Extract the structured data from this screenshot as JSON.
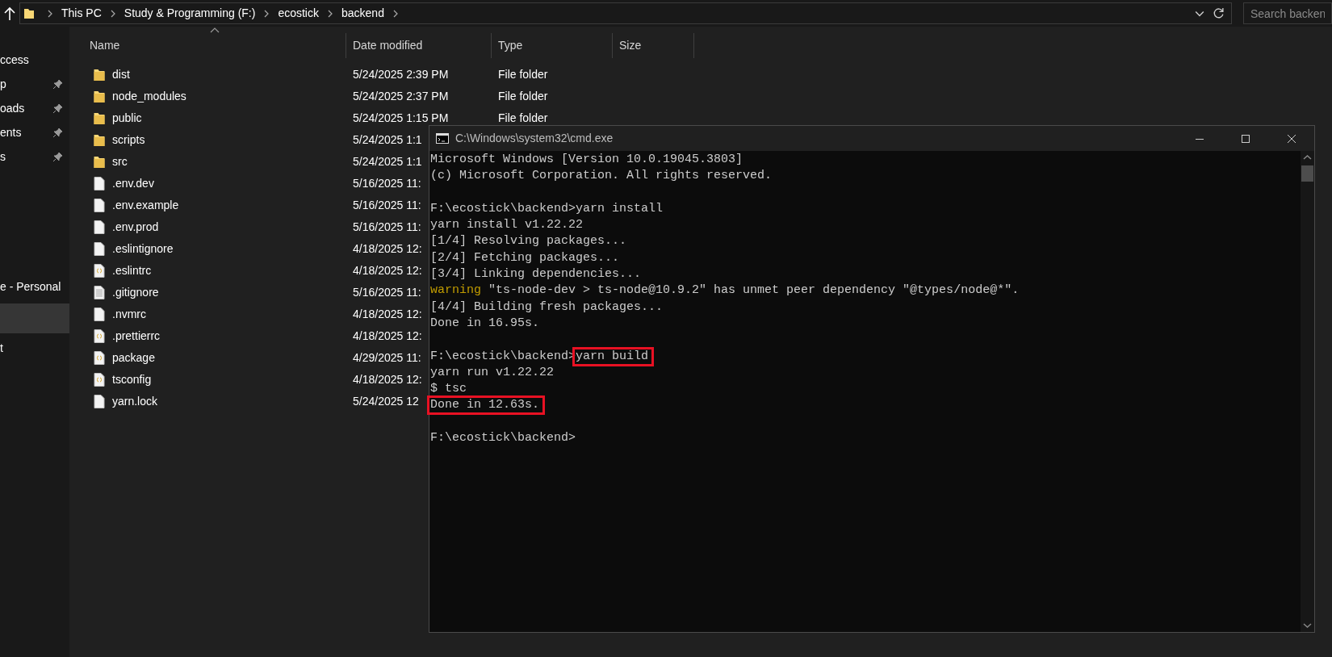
{
  "address_bar": {
    "crumbs": [
      "This PC",
      "Study & Programming (F:)",
      "ecostick",
      "backend"
    ]
  },
  "search": {
    "placeholder": "Search backen"
  },
  "sidebar": {
    "sections": [
      {
        "items": [
          {
            "label": "ccess",
            "pinned": false,
            "selected": false
          },
          {
            "label": "p",
            "pinned": true,
            "selected": false
          },
          {
            "label": "oads",
            "pinned": true,
            "selected": false
          },
          {
            "label": "ents",
            "pinned": true,
            "selected": false
          },
          {
            "label": "s",
            "pinned": true,
            "selected": false
          }
        ]
      },
      {
        "items": [
          {
            "label": "e - Personal",
            "pinned": false,
            "selected": false
          }
        ]
      },
      {
        "items": [
          {
            "selected": true,
            "pinned": false
          },
          {
            "label": "t",
            "pinned": false,
            "selected": false
          }
        ]
      }
    ]
  },
  "file_list": {
    "columns": [
      "Name",
      "Date modified",
      "Type",
      "Size"
    ],
    "rows": [
      {
        "kind": "folder",
        "name": "dist",
        "date": "5/24/2025 2:39 PM",
        "type": "File folder"
      },
      {
        "kind": "folder",
        "name": "node_modules",
        "date": "5/24/2025 2:37 PM",
        "type": "File folder"
      },
      {
        "kind": "folder",
        "name": "public",
        "date": "5/24/2025 1:15 PM",
        "type": "File folder"
      },
      {
        "kind": "folder",
        "name": "scripts",
        "date": "5/24/2025 1:1"
      },
      {
        "kind": "folder",
        "name": "src",
        "date": "5/24/2025 1:1"
      },
      {
        "kind": "file",
        "name": ".env.dev",
        "date": "5/16/2025 11:"
      },
      {
        "kind": "file",
        "name": ".env.example",
        "date": "5/16/2025 11:"
      },
      {
        "kind": "file",
        "name": ".env.prod",
        "date": "5/16/2025 11:"
      },
      {
        "kind": "file",
        "name": ".eslintignore",
        "date": "4/18/2025 12:"
      },
      {
        "kind": "json",
        "name": ".eslintrc",
        "date": "4/18/2025 12:"
      },
      {
        "kind": "text",
        "name": ".gitignore",
        "date": "5/16/2025 11:"
      },
      {
        "kind": "file",
        "name": ".nvmrc",
        "date": "4/18/2025 12:"
      },
      {
        "kind": "json",
        "name": ".prettierrc",
        "date": "4/18/2025 12:"
      },
      {
        "kind": "json",
        "name": "package",
        "date": "4/29/2025 11:"
      },
      {
        "kind": "json",
        "name": "tsconfig",
        "date": "4/18/2025 12:"
      },
      {
        "kind": "file",
        "name": "yarn.lock",
        "date": "5/24/2025 12"
      }
    ]
  },
  "terminal": {
    "title": "C:\\Windows\\system32\\cmd.exe",
    "lines": [
      {
        "kind": "text",
        "parts": [
          {
            "kind": "plain",
            "text": "Microsoft Windows [Version 10.0.19045.3803]"
          }
        ]
      },
      {
        "kind": "text",
        "parts": [
          {
            "kind": "plain",
            "text": "(c) Microsoft Corporation. All rights reserved."
          }
        ]
      },
      {
        "kind": "blank"
      },
      {
        "kind": "text",
        "parts": [
          {
            "kind": "plain",
            "text": "F:\\ecostick\\backend>yarn install"
          }
        ]
      },
      {
        "kind": "text",
        "parts": [
          {
            "kind": "plain",
            "text": "yarn install v1.22.22"
          }
        ]
      },
      {
        "kind": "text",
        "parts": [
          {
            "kind": "plain",
            "text": "[1/4] Resolving packages..."
          }
        ]
      },
      {
        "kind": "text",
        "parts": [
          {
            "kind": "plain",
            "text": "[2/4] Fetching packages..."
          }
        ]
      },
      {
        "kind": "text",
        "parts": [
          {
            "kind": "plain",
            "text": "[3/4] Linking dependencies..."
          }
        ]
      },
      {
        "kind": "text",
        "parts": [
          {
            "kind": "warning",
            "text": "warning"
          },
          {
            "kind": "plain",
            "text": "\"ts-node-dev > ts-node@10.9.2\" has unmet peer dependency \"@types/node@*\"."
          }
        ]
      },
      {
        "kind": "text",
        "parts": [
          {
            "kind": "plain",
            "text": "[4/4] Building fresh packages..."
          }
        ]
      },
      {
        "kind": "text",
        "parts": [
          {
            "kind": "plain",
            "text": "Done in 16.95s."
          }
        ]
      },
      {
        "kind": "blank"
      },
      {
        "kind": "text",
        "parts": [
          {
            "kind": "plain",
            "text": "F:\\ecostick\\backend>"
          },
          {
            "kind": "highlight",
            "text": "yarn build"
          }
        ]
      },
      {
        "kind": "text",
        "parts": [
          {
            "kind": "plain",
            "text": "yarn run v1.22.22"
          }
        ]
      },
      {
        "kind": "text",
        "parts": [
          {
            "kind": "plain",
            "text": "$ tsc"
          }
        ]
      },
      {
        "kind": "text",
        "parts": [
          {
            "kind": "highlight",
            "text": "Done in 12.63s."
          }
        ]
      },
      {
        "kind": "blank"
      },
      {
        "kind": "text",
        "parts": [
          {
            "kind": "plain",
            "text": "F:\\ecostick\\backend>"
          }
        ]
      }
    ]
  }
}
